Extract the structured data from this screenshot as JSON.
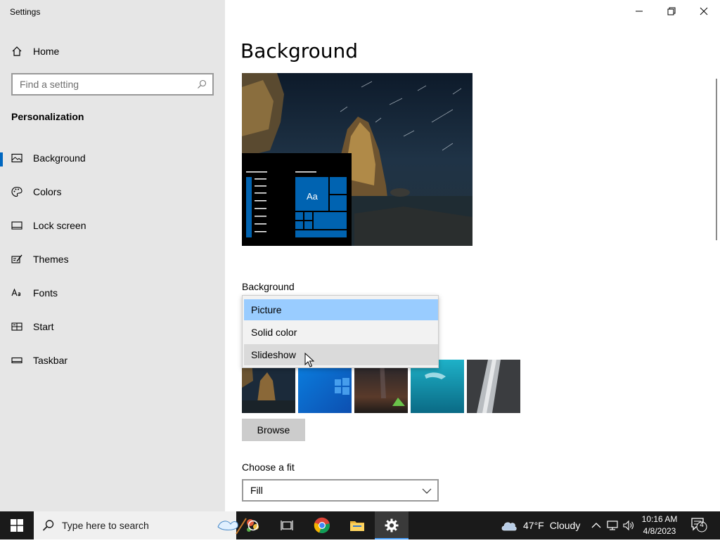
{
  "window": {
    "title": "Settings",
    "controls": {
      "minimize": "minimize",
      "restore": "restore",
      "close": "close"
    }
  },
  "sidebar": {
    "home_label": "Home",
    "search_placeholder": "Find a setting",
    "section_title": "Personalization",
    "items": [
      {
        "label": "Background",
        "icon": "picture-icon",
        "selected": true
      },
      {
        "label": "Colors",
        "icon": "palette-icon",
        "selected": false
      },
      {
        "label": "Lock screen",
        "icon": "lock-screen-icon",
        "selected": false
      },
      {
        "label": "Themes",
        "icon": "themes-icon",
        "selected": false
      },
      {
        "label": "Fonts",
        "icon": "fonts-icon",
        "selected": false
      },
      {
        "label": "Start",
        "icon": "start-icon",
        "selected": false
      },
      {
        "label": "Taskbar",
        "icon": "taskbar-icon",
        "selected": false
      }
    ]
  },
  "main": {
    "title": "Background",
    "preview": {
      "tile_text": "Aa"
    },
    "background_label": "Background",
    "background_options": [
      {
        "label": "Picture",
        "state": "selected"
      },
      {
        "label": "Solid color",
        "state": "normal"
      },
      {
        "label": "Slideshow",
        "state": "hover"
      }
    ],
    "browse_label": "Browse",
    "fit_label": "Choose a fit",
    "fit_value": "Fill"
  },
  "taskbar": {
    "search_text": "Type here to search",
    "weather_temp": "47°F",
    "weather_condition": "Cloudy",
    "time": "10:16 AM",
    "date": "4/8/2023",
    "notification_count": "4"
  },
  "colors": {
    "accent": "#0067c0",
    "dropdown_selected": "#99ccff",
    "sidebar_bg": "#e6e6e6",
    "taskbar_bg": "#1a1a1a"
  }
}
